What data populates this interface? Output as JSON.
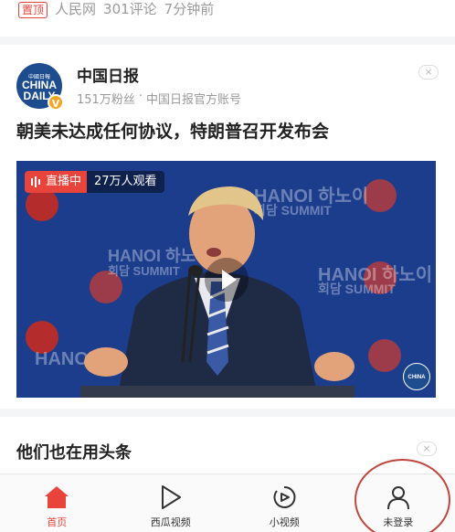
{
  "top_meta": {
    "badge": "置顶",
    "source": "人民网",
    "comments": "301评论",
    "time": "7分钟前"
  },
  "card": {
    "author": {
      "name": "中国日报",
      "avatar_cn": "中國日報",
      "avatar_en1": "CHINA",
      "avatar_en2": "DAILY",
      "verified_badge": "V",
      "followers": "151万粉丝",
      "dot": "·",
      "account_desc": "中国日报官方账号"
    },
    "dislike_icon": "×",
    "headline": "朝美未达成任何协议，特朗普召开发布会",
    "video": {
      "live_label": "直播中",
      "viewers": "27万人观看",
      "bg_text_1": "HANOI 하노이",
      "bg_text_2": "회담 SUMMIT",
      "watermark": "CHINA DAILY"
    }
  },
  "section": {
    "title": "他们也在用头条",
    "close_icon": "×"
  },
  "tabbar": {
    "tabs": [
      {
        "label": "首页",
        "icon": "home-icon",
        "active": true
      },
      {
        "label": "西瓜视频",
        "icon": "play-icon",
        "active": false
      },
      {
        "label": "小视频",
        "icon": "small-video-icon",
        "active": false
      },
      {
        "label": "未登录",
        "icon": "user-icon",
        "active": false
      }
    ]
  },
  "colors": {
    "accent": "#e8443c",
    "video_bg": "#1c3d8c",
    "avatar_bg": "#1d4c8f"
  }
}
